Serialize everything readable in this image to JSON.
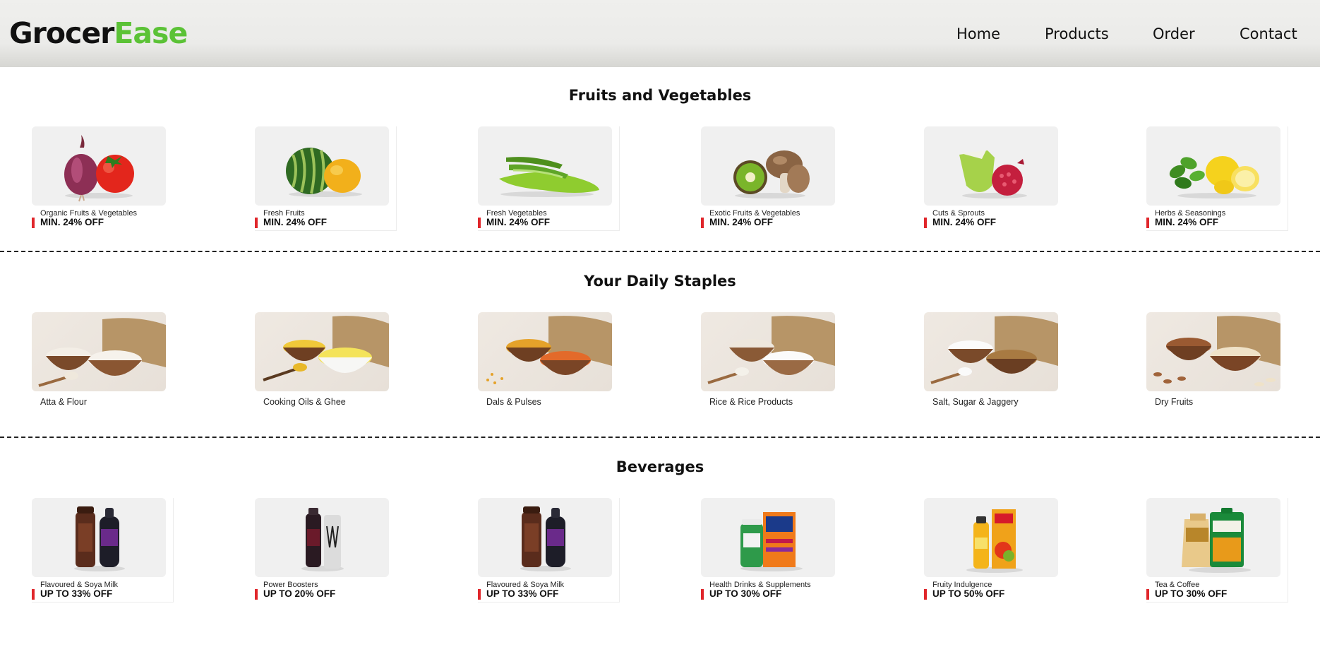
{
  "header": {
    "logo_part1": "Grocer",
    "logo_part2": "Ease",
    "nav": [
      "Home",
      "Products",
      "Order",
      "Contact"
    ]
  },
  "colors": {
    "brand_green": "#5bc236",
    "offer_bar_red": "#e0262b",
    "header_bg": "#ebebe9"
  },
  "sections": [
    {
      "title": "Fruits and Vegetables",
      "items": [
        {
          "label": "Organic Fruits & Vegetables",
          "offer": "MIN. 24% OFF",
          "icon": "onion-tomato-image"
        },
        {
          "label": "Fresh Fruits",
          "offer": "MIN. 24% OFF",
          "icon": "watermelon-mango-image"
        },
        {
          "label": "Fresh Vegetables",
          "offer": "MIN. 24% OFF",
          "icon": "okra-gourd-image"
        },
        {
          "label": "Exotic Fruits & Vegetables",
          "offer": "MIN. 24% OFF",
          "icon": "kiwi-mushroom-image"
        },
        {
          "label": "Cuts & Sprouts",
          "offer": "MIN. 24% OFF",
          "icon": "coconut-pomegranate-image"
        },
        {
          "label": "Herbs & Seasonings",
          "offer": "MIN. 24% OFF",
          "icon": "mint-lemon-image"
        }
      ]
    },
    {
      "title": "Your Daily Staples",
      "items": [
        {
          "label": "Atta & Flour",
          "icon": "flour-bowls-image"
        },
        {
          "label": "Cooking Oils & Ghee",
          "icon": "oil-ghee-bowls-image"
        },
        {
          "label": "Dals & Pulses",
          "icon": "dal-bowls-image"
        },
        {
          "label": "Rice & Rice Products",
          "icon": "rice-bowls-image"
        },
        {
          "label": "Salt, Sugar & Jaggery",
          "icon": "salt-jaggery-bowls-image"
        },
        {
          "label": "Dry Fruits",
          "icon": "almond-cashew-bowls-image"
        }
      ]
    },
    {
      "title": "Beverages",
      "items": [
        {
          "label": "Flavoured & Soya Milk",
          "offer": "UP TO 33% OFF",
          "icon": "milk-bottles-image"
        },
        {
          "label": "Power Boosters",
          "offer": "UP TO 20% OFF",
          "icon": "energy-drink-cans-image"
        },
        {
          "label": "Flavoured & Soya Milk",
          "offer": "UP TO 33% OFF",
          "icon": "milk-bottles-image"
        },
        {
          "label": "Health Drinks & Supplements",
          "offer": "UP TO 30% OFF",
          "icon": "health-drink-jars-image"
        },
        {
          "label": "Fruity Indulgence",
          "offer": "UP TO 50% OFF",
          "icon": "juice-bottle-carton-image"
        },
        {
          "label": "Tea & Coffee",
          "offer": "UP TO 30% OFF",
          "icon": "tea-coffee-packs-image"
        }
      ]
    }
  ]
}
